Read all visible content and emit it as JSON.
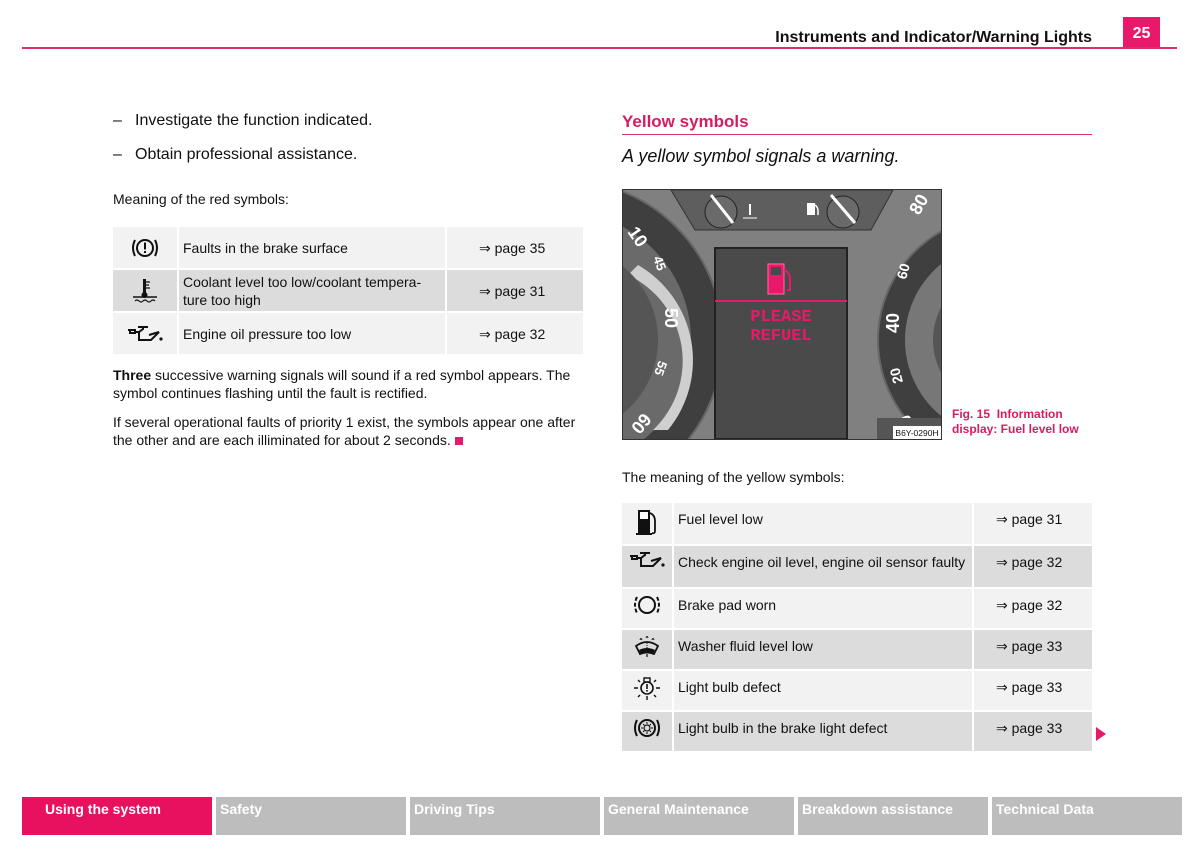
{
  "header": {
    "title": "Instruments and Indicator/Warning Lights",
    "page_number": "25",
    "accent_color": "#e8196a"
  },
  "left": {
    "bullets": [
      "Investigate the function indicated.",
      "Obtain professional assistance."
    ],
    "red_intro": "Meaning of the red symbols:",
    "red_symbols": [
      {
        "icon": "brake-warning-icon",
        "description": "Faults in the brake surface",
        "page": "⇒ page 35"
      },
      {
        "icon": "coolant-icon",
        "description": "Coolant level too low/coolant tempera-ture too high",
        "page": "⇒ page 31"
      },
      {
        "icon": "oil-can-icon",
        "description": "Engine oil pressure too low",
        "page": "⇒ page 32"
      }
    ],
    "para1_bold": "Three",
    "para1_rest": " successive warning signals will sound if a red symbol appears. The symbol continues flashing until the fault is rectified.",
    "para2": "If several operational faults of priority 1 exist, the symbols appear one after the other and are each illiminated for about 2 seconds."
  },
  "right": {
    "section_title": "Yellow symbols",
    "subtitle": "A yellow symbol signals a warning.",
    "figure": {
      "display_line1": "PLEASE",
      "display_line2": "REFUEL",
      "image_code": "B6Y-0290H",
      "speed_labels": [
        "10",
        "45",
        "50",
        "55",
        "60"
      ],
      "rpm_labels": [
        "80",
        "60",
        "40",
        "20",
        "0"
      ],
      "caption_number": "Fig. 15",
      "caption_text": "Information display: Fuel level low"
    },
    "yellow_intro": "The meaning of the yellow symbols:",
    "yellow_symbols": [
      {
        "icon": "fuel-pump-icon",
        "description": "Fuel level low",
        "page": "⇒ page 31"
      },
      {
        "icon": "oil-can-icon",
        "description": "Check engine oil level, engine oil sensor faulty",
        "page": "⇒ page 32"
      },
      {
        "icon": "brake-pad-icon",
        "description": "Brake pad worn",
        "page": "⇒ page 32"
      },
      {
        "icon": "washer-fluid-icon",
        "description": "Washer fluid level low",
        "page": "⇒ page 33"
      },
      {
        "icon": "bulb-defect-icon",
        "description": "Light bulb defect",
        "page": "⇒ page 33"
      },
      {
        "icon": "brake-light-icon",
        "description": "Light bulb in the brake light defect",
        "page": "⇒ page 33"
      }
    ]
  },
  "footer": {
    "tabs": [
      {
        "label": "Using the system",
        "active": true
      },
      {
        "label": "Safety"
      },
      {
        "label": "Driving Tips"
      },
      {
        "label": "General Maintenance"
      },
      {
        "label": "Breakdown assistance"
      },
      {
        "label": "Technical Data"
      }
    ]
  }
}
